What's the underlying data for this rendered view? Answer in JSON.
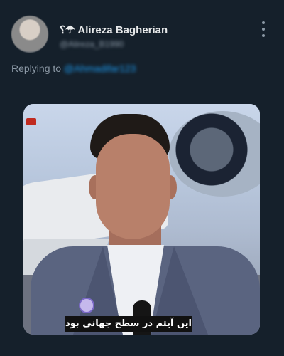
{
  "tweet": {
    "name_prefix": "⸮☂",
    "display_name": "Alireza Bagherian",
    "handle": "@Alireza_B1990",
    "replying_label": "Replying to",
    "replying_handle": "@Ahmadifar123",
    "more_icon": "more-vertical-icon"
  },
  "media": {
    "subtitle": "این آیتم در سطح جهانی بود"
  }
}
